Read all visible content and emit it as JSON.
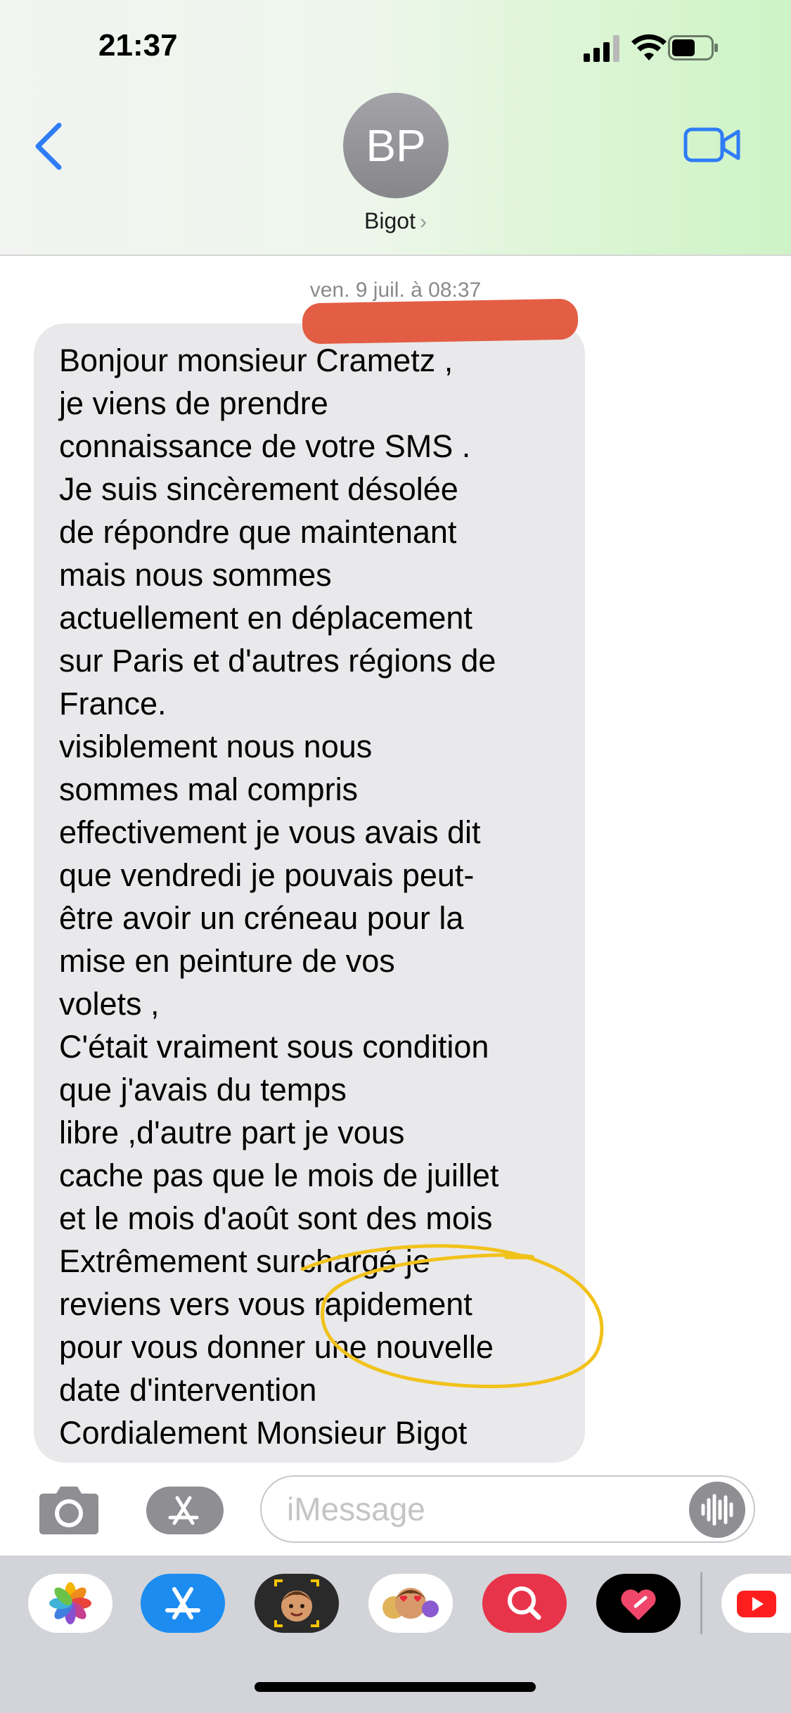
{
  "status_bar": {
    "time": "21:37"
  },
  "header": {
    "avatar_initials": "BP",
    "contact_name": "Bigot",
    "chevron": "›"
  },
  "thread": {
    "timestamp": "ven. 9 juil. à 08:37",
    "message": "Bonjour monsieur Crametz ,\nje viens de prendre\nconnaissance de votre SMS .\nJe suis sincèrement désolée\nde répondre que maintenant\nmais nous sommes\nactuellement en déplacement\nsur Paris et d'autres régions de\nFrance.\nvisiblement nous nous\nsommes mal compris\neffectivement je vous avais dit\nque vendredi je pouvais peut-\nêtre avoir un créneau pour la\nmise en peinture de vos\nvolets ,\nC'était vraiment sous condition\nque j'avais du temps\nlibre ,d'autre part je vous\ncache pas que le mois de juillet\net le mois d'août sont des mois\nExtrêmement surchargé je\nreviens vers vous rapidement\npour vous donner une nouvelle\ndate d'intervention\nCordialement Monsieur Bigot"
  },
  "composer": {
    "placeholder": "iMessage"
  },
  "colors": {
    "accent": "#2f7cf6",
    "bubble": "#e9e9eb",
    "redaction": "#e2553a",
    "annotation": "#f2c21c"
  },
  "icons": [
    "back-chevron-icon",
    "video-camera-icon",
    "camera-icon",
    "app-store-icon",
    "audio-waveform-icon",
    "photos-app-icon",
    "app-store-app-icon",
    "memoji-app-icon",
    "heart-eyes-memoji-app-icon",
    "search-images-app-icon",
    "digital-touch-app-icon",
    "youtube-app-icon"
  ]
}
